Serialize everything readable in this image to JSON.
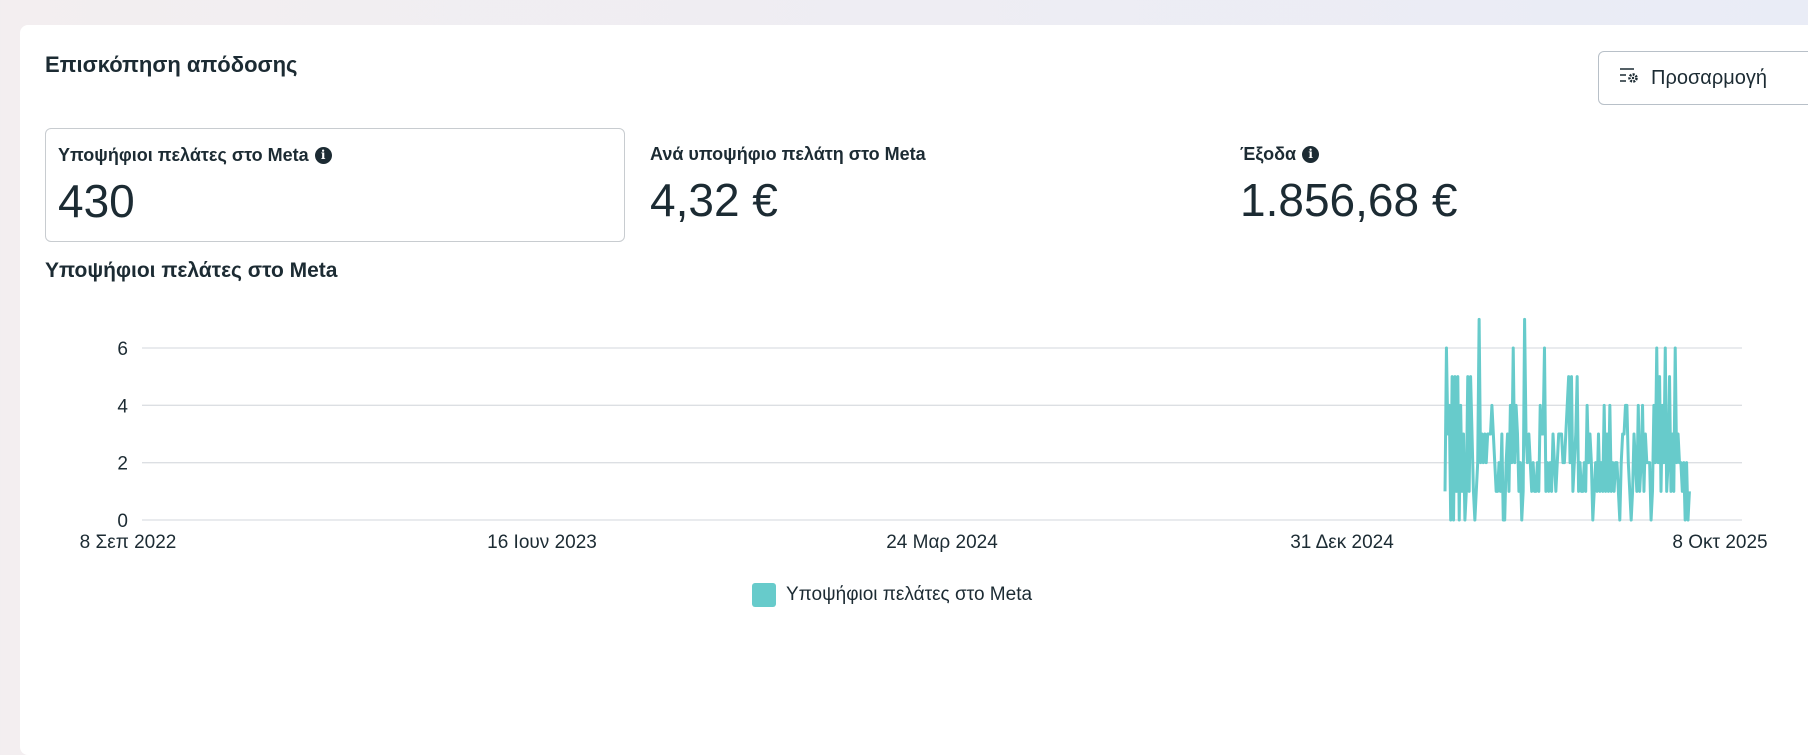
{
  "header": {
    "title": "Επισκόπηση απόδοσης",
    "customize_label": "Προσαρμογή"
  },
  "kpis": [
    {
      "label": "Υποψήφιοι πελάτες στο Meta",
      "value": "430",
      "info": true
    },
    {
      "label": "Ανά υποψήφιο πελάτη στο Meta",
      "value": "4,32 €"
    },
    {
      "label": "Έξοδα",
      "value": "1.856,68 €",
      "info": true
    }
  ],
  "colors": {
    "series": "#67cbcb",
    "grid": "#dcdfe3"
  },
  "chart_data": {
    "type": "line",
    "title": "Υποψήφιοι πελάτες στο Meta",
    "xlabel": "",
    "ylabel": "",
    "ylim": [
      0,
      7
    ],
    "yticks": [
      0,
      2,
      4,
      6
    ],
    "xticks": [
      "8 Σεπ 2022",
      "16 Ιουν 2023",
      "24 Μαρ 2024",
      "31 Δεκ 2024",
      "8 Οκτ 2025"
    ],
    "x_range_days": [
      0,
      1126
    ],
    "series_start_day": 917,
    "legend": "bottom-center",
    "series": [
      {
        "name": "Υποψήφιοι πελάτες στο Μeta",
        "values": [
          1,
          6,
          3,
          4,
          0,
          5,
          0,
          5,
          1,
          5,
          0,
          4,
          1,
          3,
          0,
          1,
          5,
          1,
          5,
          3,
          1,
          0,
          1,
          2,
          7,
          2,
          3,
          2,
          3,
          2,
          3,
          3,
          3,
          4,
          3,
          2,
          1,
          1,
          2,
          1,
          3,
          0,
          0,
          2,
          3,
          1,
          4,
          2,
          6,
          2,
          4,
          3,
          1,
          2,
          0,
          1,
          7,
          3,
          2,
          3,
          2,
          1,
          2,
          1,
          1,
          2,
          1,
          4,
          3,
          3,
          6,
          1,
          2,
          1,
          2,
          1,
          3,
          2,
          1,
          2,
          3,
          3,
          3,
          2,
          2,
          3,
          4,
          5,
          2,
          5,
          1,
          2,
          3,
          5,
          1,
          2,
          1,
          1,
          2,
          1,
          4,
          2,
          3,
          2,
          0,
          1,
          2,
          1,
          3,
          1,
          2,
          1,
          4,
          1,
          3,
          1,
          4,
          1,
          2,
          1,
          2,
          2,
          1,
          0,
          2,
          3,
          3,
          4,
          4,
          2,
          1,
          0,
          1,
          3,
          2,
          1,
          4,
          1,
          2,
          4,
          1,
          3,
          2,
          2,
          2,
          0,
          1,
          4,
          2,
          6,
          2,
          5,
          1,
          4,
          2,
          6,
          1,
          2,
          5,
          1,
          3,
          1,
          6,
          2,
          3,
          2,
          2,
          1,
          2,
          0,
          2,
          0,
          1
        ]
      }
    ]
  }
}
